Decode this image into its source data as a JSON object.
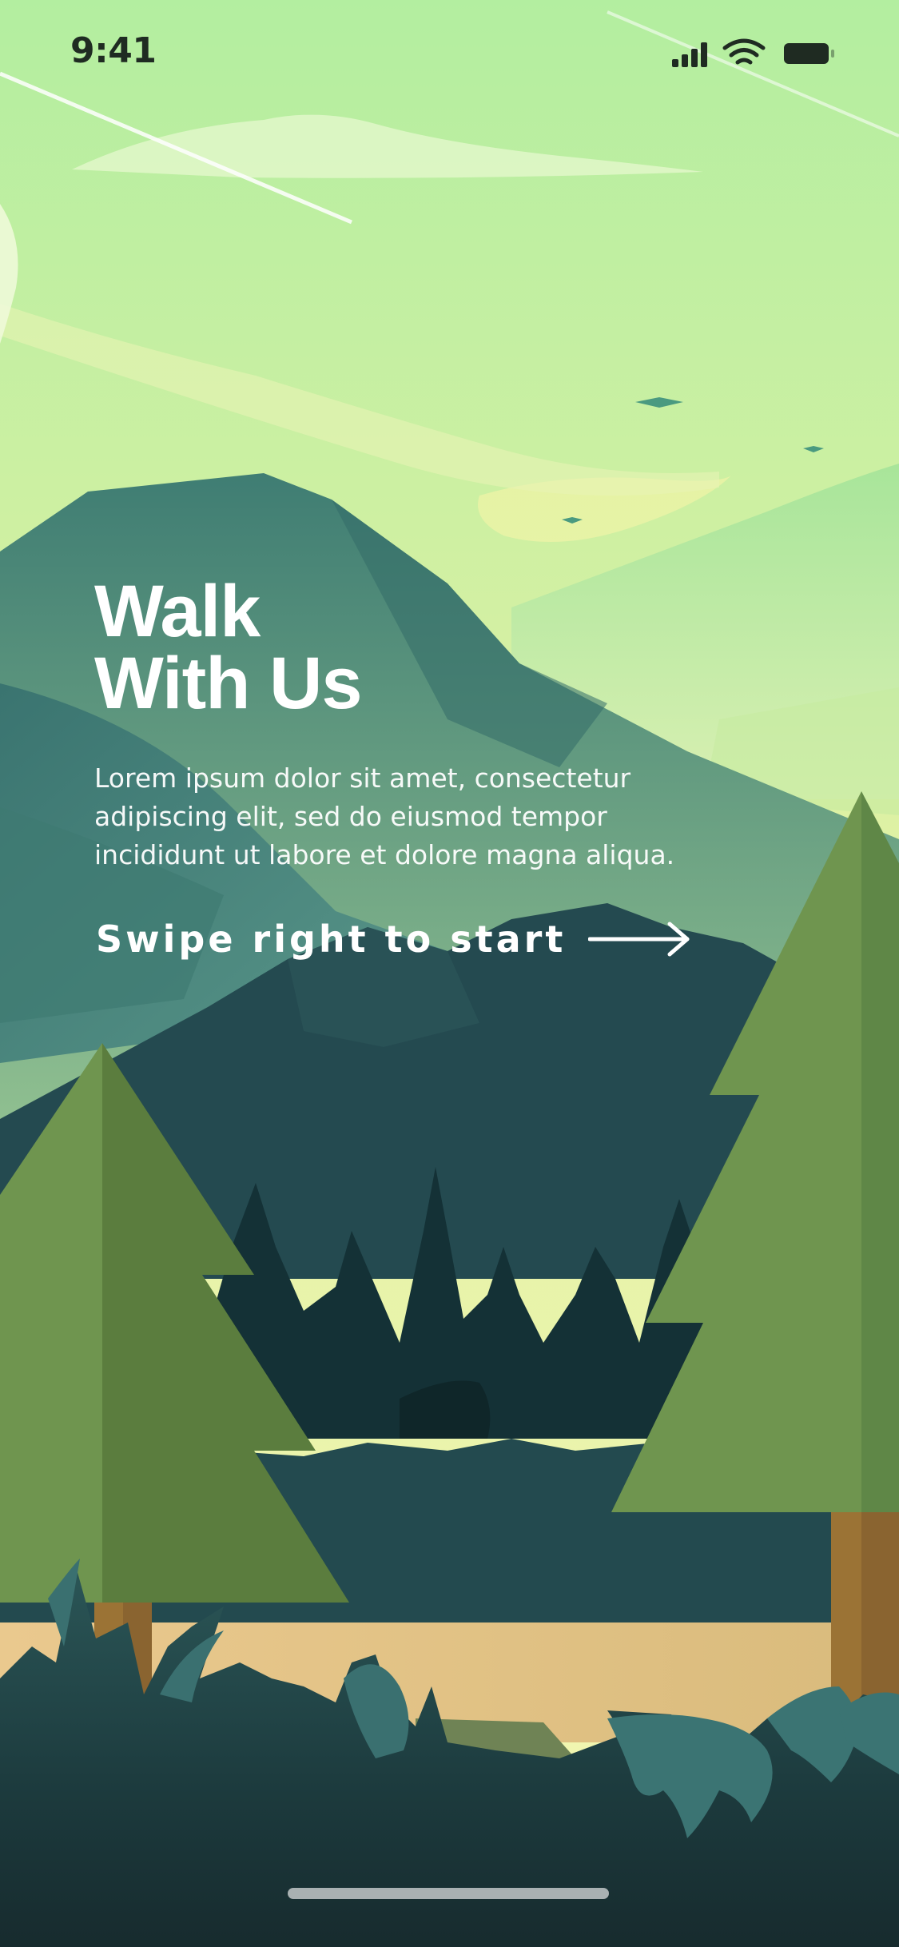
{
  "status_bar": {
    "time": "9:41",
    "icons": [
      "cellular-signal-icon",
      "wifi-icon",
      "battery-icon"
    ]
  },
  "onboarding": {
    "headline_line1": "Walk",
    "headline_line2": "With Us",
    "body": "Lorem ipsum dolor sit amet, consectetur adipiscing elit, sed do eiusmod tempor incididunt ut labore et dolore magna aliqua.",
    "cta_label": "Swipe right to start",
    "cta_icon": "arrow-right-icon"
  },
  "colors": {
    "sky_top": "#b5efa0",
    "sky_bottom": "#f3f6b2",
    "mountain_far": "#4b8a7c",
    "mountain_near": "#244a50",
    "tree": "#6f954f",
    "tree_shade": "#5b7d3e",
    "trunk": "#9b7335",
    "path": "#e6c48a",
    "foreground": "#1a3236",
    "text": "#ffffff"
  }
}
